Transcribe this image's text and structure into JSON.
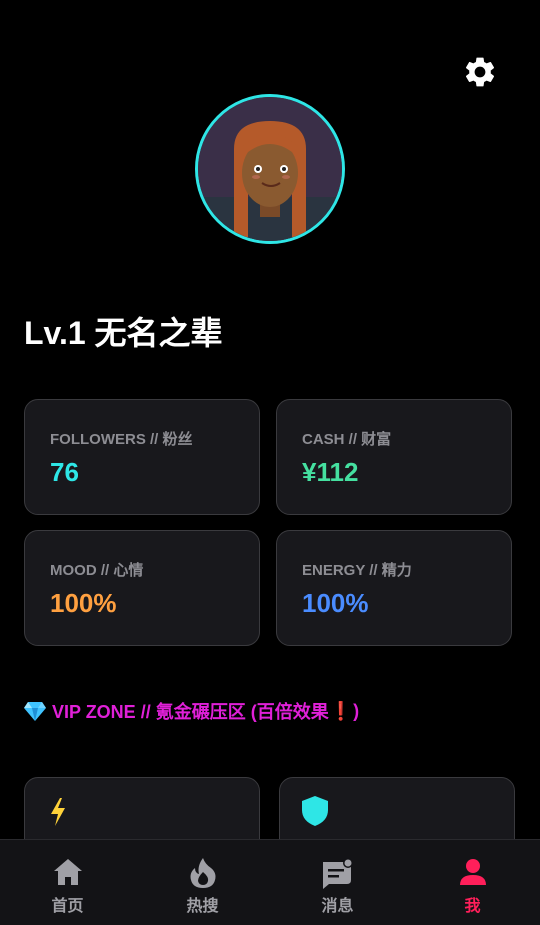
{
  "header": {
    "settings_icon": "gear-icon"
  },
  "profile": {
    "level_name": "Lv.1 无名之辈",
    "avatar_icon": "avatar-portrait",
    "avatar_ring_color": "#2ee6e6"
  },
  "stats": [
    {
      "label": "FOLLOWERS // 粉丝",
      "value": "76",
      "color": "#2ee6e6"
    },
    {
      "label": "CASH // 财富",
      "value": "¥112",
      "color": "#45e0a0"
    },
    {
      "label": "MOOD // 心情",
      "value": "100%",
      "color": "#ffa040"
    },
    {
      "label": "ENERGY // 精力",
      "value": "100%",
      "color": "#4a8cff"
    }
  ],
  "vip": {
    "icon": "diamond-icon",
    "text": "VIP ZONE // 氪金碾压区 (百倍效果",
    "exclaim": "❗",
    "close": ")",
    "color": "#e020d8"
  },
  "features": [
    {
      "icon": "lightning-icon",
      "color": "#ffd23a"
    },
    {
      "icon": "shield-icon",
      "color": "#2ee6e6"
    }
  ],
  "tabbar": {
    "active_color": "#ff1f5a",
    "items": [
      {
        "label": "首页",
        "icon": "home-icon"
      },
      {
        "label": "热搜",
        "icon": "flame-icon"
      },
      {
        "label": "消息",
        "icon": "message-icon"
      },
      {
        "label": "我",
        "icon": "person-icon",
        "active": true
      }
    ]
  }
}
